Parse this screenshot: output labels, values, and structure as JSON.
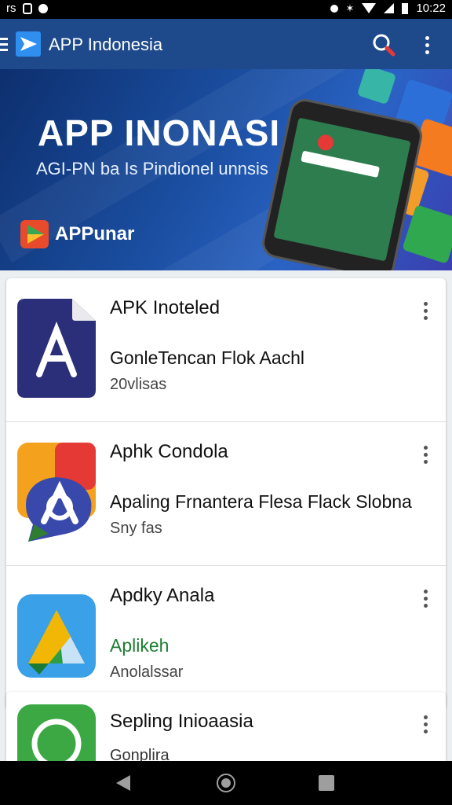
{
  "status_bar": {
    "left_text": "rs",
    "time": "10:22"
  },
  "app_bar": {
    "title": "APP Indonesia"
  },
  "banner": {
    "title": "APP INONASI",
    "subtitle": "AGI-PN ba Is Pindionel unnsis",
    "brand": "APPunar"
  },
  "apps": [
    {
      "title": "APK Inoteled",
      "description": "GonleTencan Flok Aachl",
      "meta": "20vlisas",
      "meta_color": "#444444",
      "icon": "document-a-icon"
    },
    {
      "title": "Aphk Condola",
      "description": "Apaling Frnantera Flesa Flack Slobna",
      "meta": "Sny fas",
      "meta_color": "#444444",
      "icon": "colorful-a-logo-icon"
    },
    {
      "title": "Apdky Anala",
      "description": "Aplikeh",
      "description_color": "#1e7d32",
      "meta": "Anolalssar",
      "meta_color": "#444444",
      "icon": "triangle-a-icon"
    },
    {
      "title": "Sepling Inioaasia",
      "description": "Gonplira",
      "icon": "whatsapp-icon"
    }
  ]
}
